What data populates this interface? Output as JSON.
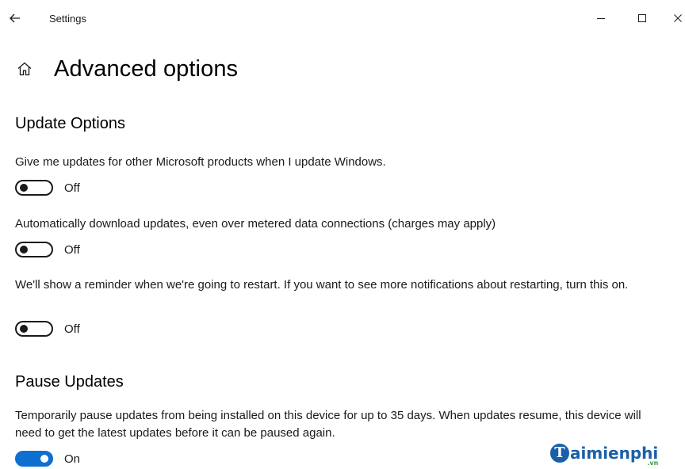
{
  "titlebar": {
    "back_icon": "back-arrow-icon",
    "title": "Settings",
    "minimize_icon": "minimize-icon",
    "maximize_icon": "maximize-icon",
    "close_icon": "close-icon"
  },
  "header": {
    "home_icon": "home-icon",
    "title": "Advanced options"
  },
  "update_options": {
    "title": "Update Options",
    "settings": [
      {
        "description": "Give me updates for other Microsoft products when I update Windows.",
        "state": "Off"
      },
      {
        "description": "Automatically download updates, even over metered data connections (charges may apply)",
        "state": "Off"
      },
      {
        "description": "We'll show a reminder when we're going to restart. If you want to see more notifications about restarting, turn this on.",
        "state": "Off"
      }
    ]
  },
  "pause_updates": {
    "title": "Pause Updates",
    "description": "Temporarily pause updates from being installed on this device for up to 35 days. When updates resume, this device will need to get the latest updates before it can be paused again.",
    "state": "On"
  },
  "watermark": {
    "logo_letter": "T",
    "name": "aimienphi",
    "tld": ".vn"
  },
  "colors": {
    "toggle_on": "#0f6fd0",
    "toggle_off": "#1a1a1a",
    "watermark": "#1a5fa8"
  }
}
